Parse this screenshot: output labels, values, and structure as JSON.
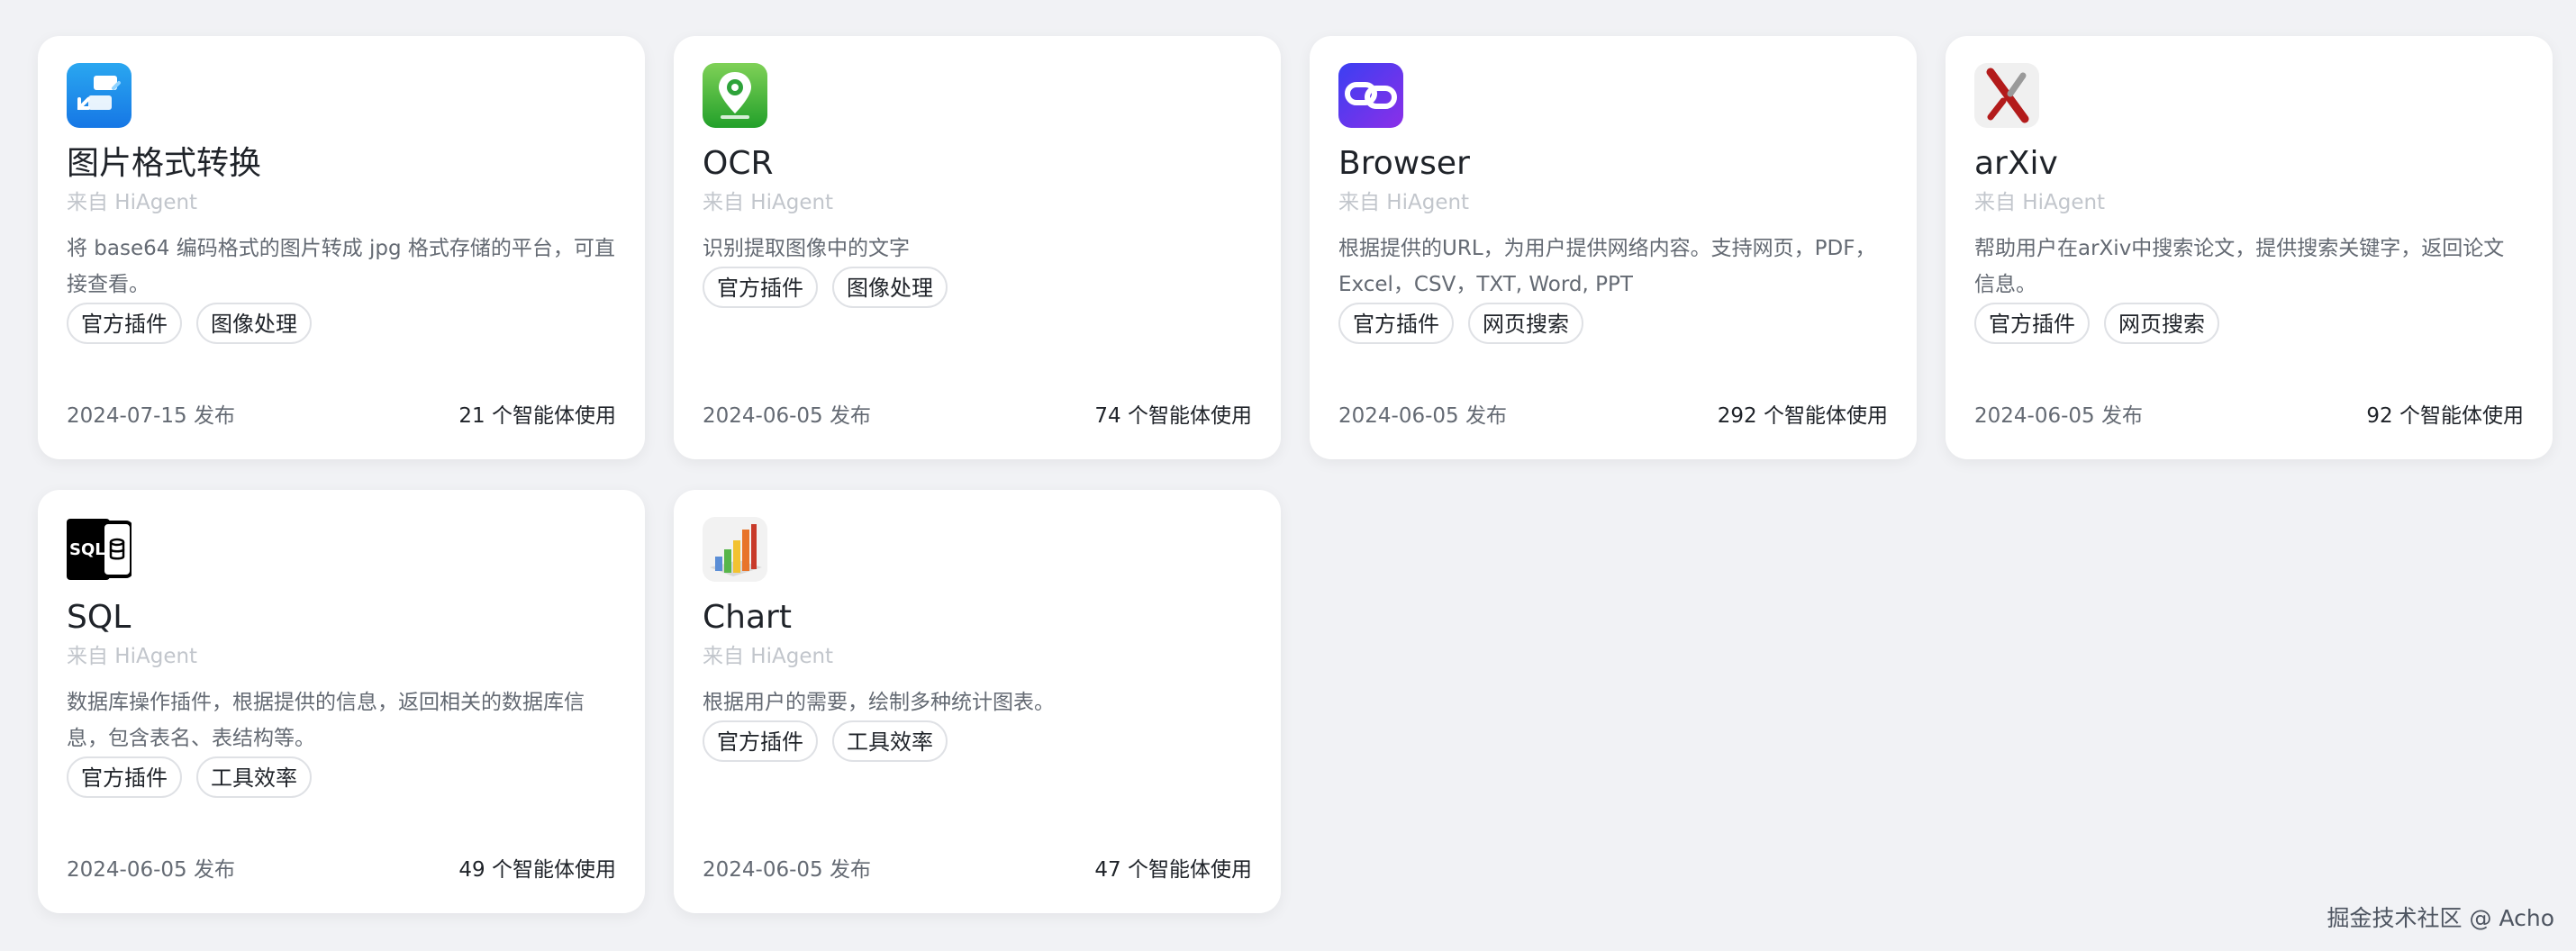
{
  "cards": [
    {
      "icon": "image-convert-icon",
      "title": "图片格式转换",
      "source": "来自 HiAgent",
      "desc": "将 base64 编码格式的图片转成 jpg 格式存储的平台，可直接查看。",
      "tags": [
        "官方插件",
        "图像处理"
      ],
      "date": "2024-07-15 发布",
      "usage": "21 个智能体使用"
    },
    {
      "icon": "ocr-location-icon",
      "title": "OCR",
      "source": "来自 HiAgent",
      "desc": "识别提取图像中的文字",
      "tags": [
        "官方插件",
        "图像处理"
      ],
      "date": "2024-06-05 发布",
      "usage": "74 个智能体使用"
    },
    {
      "icon": "browser-link-icon",
      "title": "Browser",
      "source": "来自 HiAgent",
      "desc": "根据提供的URL，为用户提供网络内容。支持网页，PDF，Excel，CSV，TXT, Word, PPT",
      "tags": [
        "官方插件",
        "网页搜索"
      ],
      "date": "2024-06-05 发布",
      "usage": "292 个智能体使用"
    },
    {
      "icon": "arxiv-icon",
      "title": "arXiv",
      "source": "来自 HiAgent",
      "desc": "帮助用户在arXiv中搜索论文，提供搜索关键字，返回论文信息。",
      "tags": [
        "官方插件",
        "网页搜索"
      ],
      "date": "2024-06-05 发布",
      "usage": "92 个智能体使用"
    },
    {
      "icon": "sql-database-icon",
      "title": "SQL",
      "source": "来自 HiAgent",
      "desc": "数据库操作插件，根据提供的信息，返回相关的数据库信息，包含表名、表结构等。",
      "tags": [
        "官方插件",
        "工具效率"
      ],
      "date": "2024-06-05 发布",
      "usage": "49 个智能体使用"
    },
    {
      "icon": "bar-chart-icon",
      "title": "Chart",
      "source": "来自 HiAgent",
      "desc": "根据用户的需要，绘制多种统计图表。",
      "tags": [
        "官方插件",
        "工具效率"
      ],
      "date": "2024-06-05 发布",
      "usage": "47 个智能体使用"
    }
  ],
  "watermark": "掘金技术社区 @ Acho"
}
